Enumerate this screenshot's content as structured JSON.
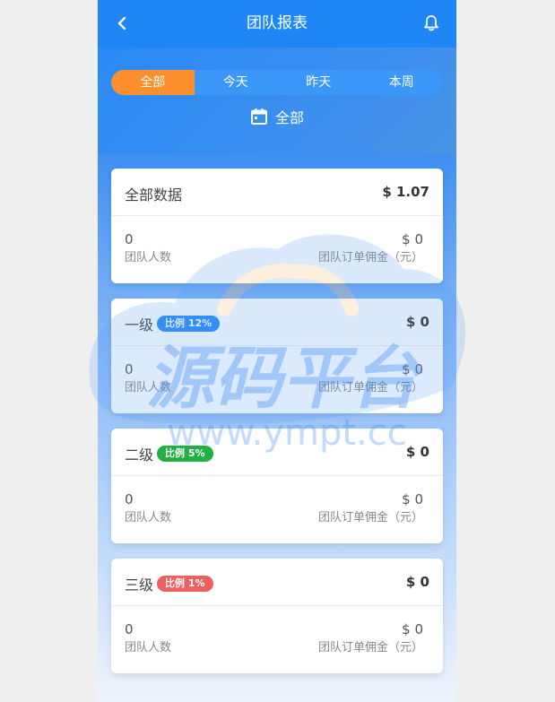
{
  "header": {
    "title": "团队报表",
    "back_icon": "back-arrow-icon",
    "bell_icon": "bell-icon"
  },
  "tabs": [
    {
      "label": "全部",
      "active": true
    },
    {
      "label": "今天",
      "active": false
    },
    {
      "label": "昨天",
      "active": false
    },
    {
      "label": "本周",
      "active": false
    }
  ],
  "date_filter": {
    "icon": "calendar-icon",
    "label": "全部"
  },
  "summary": {
    "title": "全部数据",
    "amount": "$ 1.07",
    "members_value": "0",
    "members_label": "团队人数",
    "commission_value": "$ 0",
    "commission_label": "团队订单佣金（元）"
  },
  "levels": [
    {
      "title": "一级",
      "badge": "比例 12%",
      "badge_color": "#2a8af6",
      "amount": "$ 0",
      "members_value": "0",
      "members_label": "团队人数",
      "commission_value": "$ 0",
      "commission_label": "团队订单佣金（元）"
    },
    {
      "title": "二级",
      "badge": "比例 5%",
      "badge_color": "#21b141",
      "amount": "$ 0",
      "members_value": "0",
      "members_label": "团队人数",
      "commission_value": "$ 0",
      "commission_label": "团队订单佣金（元）"
    },
    {
      "title": "三级",
      "badge": "比例 1%",
      "badge_color": "#ee5f5f",
      "amount": "$ 0",
      "members_value": "0",
      "members_label": "团队人数",
      "commission_value": "$ 0",
      "commission_label": "团队订单佣金（元）"
    }
  ],
  "watermark": {
    "text": "源码平台",
    "url": "www.ympt.cc"
  },
  "colors": {
    "primary": "#1f86f5",
    "accent": "#fd8f2d"
  }
}
